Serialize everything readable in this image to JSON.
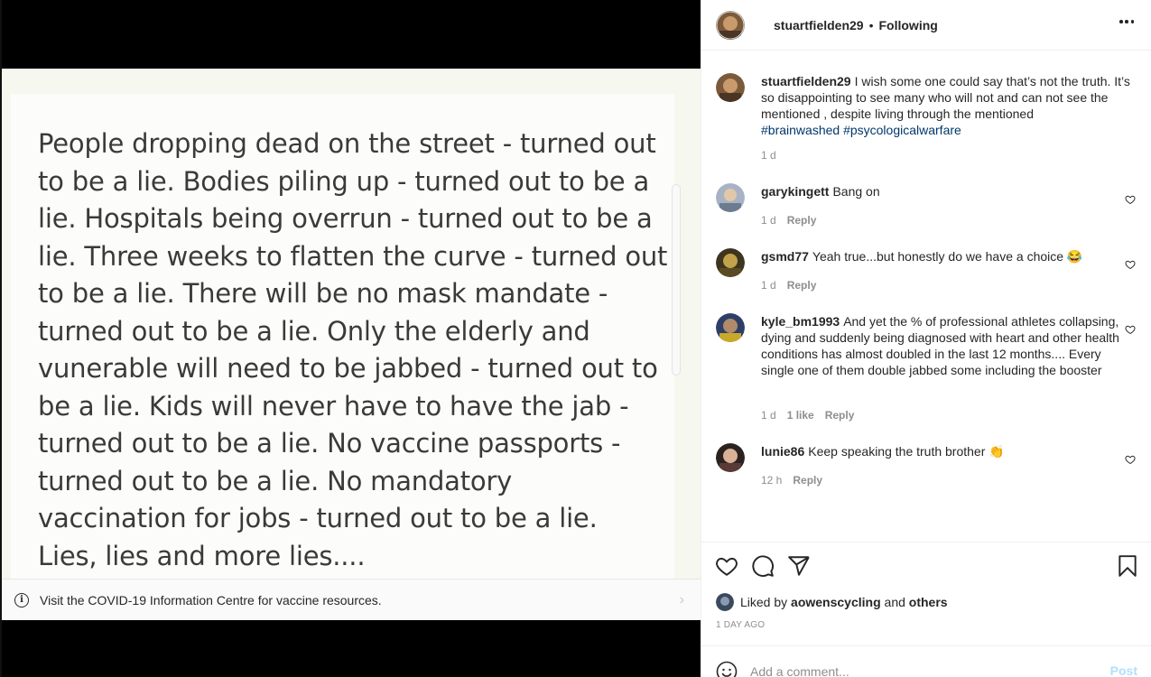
{
  "post": {
    "image_lines": [
      "People dropping dead on the street - turned out",
      "to be a lie. Bodies piling up - turned out to be a",
      "lie. Hospitals being overrun - turned out to be a",
      "lie. Three weeks to flatten the curve - turned out",
      "to be a lie. There will be no mask mandate -",
      "turned out to be a lie. Only the elderly and",
      "vunerable will need to be jabbed - turned out to",
      "be a lie. Kids will never have to have the jab -",
      "turned out to be a lie. No vaccine passports -",
      "turned out to be a lie. No mandatory",
      "vaccination for jobs - turned out to be a lie.",
      "Lies, lies and more lies...."
    ],
    "covid_banner": "Visit the COVID-19 Information Centre for vaccine resources.",
    "covid_icon": "info-icon",
    "chevron_icon": "chevron-right-icon"
  },
  "header": {
    "username": "stuartfielden29",
    "separator": "•",
    "follow_status": "Following",
    "more_icon": "more-options-icon"
  },
  "caption": {
    "username": "stuartfielden29",
    "text": "I wish some one could say that’s not the truth. It’s so disappointing to see many who will not and can not see the mentioned , despite living through the mentioned",
    "hashtags": [
      "#brainwashed",
      "#psycological",
      "warfare"
    ],
    "time": "1 d"
  },
  "comments": [
    {
      "username": "garykingett",
      "text": "Bang on",
      "time": "1 d",
      "likes": "",
      "reply": "Reply"
    },
    {
      "username": "gsmd77",
      "text": "Yeah true...but honestly do we have a choice 😂",
      "time": "1 d",
      "likes": "",
      "reply": "Reply"
    },
    {
      "username": "kyle_bm1993",
      "text": "And yet the % of professional athletes collapsing, dying and suddenly being diagnosed with heart and other health conditions has almost doubled in the last 12 months.... Every single one of them double jabbed some including the booster",
      "time": "1 d",
      "likes": "1 like",
      "reply": "Reply"
    },
    {
      "username": "lunie86",
      "text": "Keep speaking the truth brother 👏",
      "time": "12 h",
      "likes": "",
      "reply": "Reply"
    }
  ],
  "actions": {
    "icons": [
      "heart-icon",
      "comment-icon",
      "share-icon",
      "bookmark-icon"
    ],
    "liked_prefix": "Liked by",
    "liked_user": "aowenscycling",
    "liked_and": "and",
    "liked_others": "others",
    "time_ago": "1 DAY AGO"
  },
  "add_comment": {
    "placeholder": "Add a comment...",
    "post_label": "Post",
    "emoji_icon": "emoji-icon"
  },
  "colors": {
    "link": "#00376b",
    "muted": "#8e8e8e",
    "post_disabled": "#b2dffc"
  }
}
